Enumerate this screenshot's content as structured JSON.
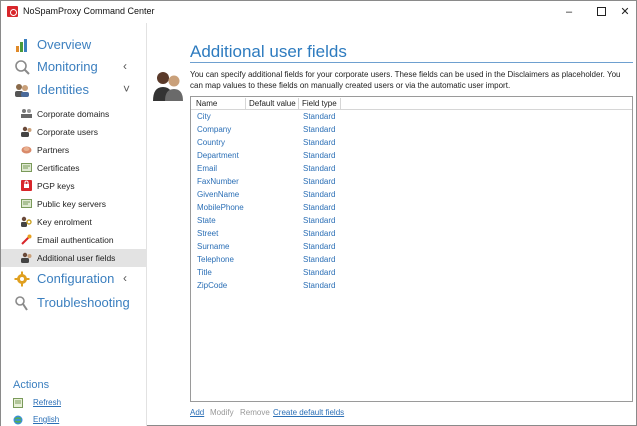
{
  "window": {
    "title": "NoSpamProxy Command Center",
    "controls": {
      "minimize": "–",
      "close": "✕"
    }
  },
  "sidebar": {
    "main_items": [
      {
        "label": "Overview",
        "icon": "overview-icon",
        "chevron": ""
      },
      {
        "label": "Monitoring",
        "icon": "monitoring-icon",
        "chevron": "‹"
      },
      {
        "label": "Identities",
        "icon": "identities-icon",
        "chevron": "˅"
      },
      {
        "label": "Configuration",
        "icon": "configuration-icon",
        "chevron": "‹"
      },
      {
        "label": "Troubleshooting",
        "icon": "troubleshooting-icon",
        "chevron": ""
      }
    ],
    "sub_items": [
      {
        "label": "Corporate domains",
        "icon": "corporate-domains-icon"
      },
      {
        "label": "Corporate users",
        "icon": "corporate-users-icon"
      },
      {
        "label": "Partners",
        "icon": "partners-icon"
      },
      {
        "label": "Certificates",
        "icon": "certificates-icon"
      },
      {
        "label": "PGP keys",
        "icon": "pgp-keys-icon"
      },
      {
        "label": "Public key servers",
        "icon": "public-key-servers-icon"
      },
      {
        "label": "Key enrolment",
        "icon": "key-enrolment-icon"
      },
      {
        "label": "Email authentication",
        "icon": "email-authentication-icon"
      },
      {
        "label": "Additional user fields",
        "icon": "additional-user-fields-icon",
        "active": true
      }
    ],
    "actions_title": "Actions",
    "actions": [
      {
        "label": "Refresh",
        "icon": "refresh-icon"
      },
      {
        "label": "English",
        "icon": "language-globe-icon"
      }
    ]
  },
  "main": {
    "title": "Additional user fields",
    "description": "You can specify additional fields for your corporate users. These fields can be used in the Disclaimers as placeholder. You can map values to these fields on manually created users or via the automatic user import.",
    "table": {
      "columns": [
        "Name",
        "Default value",
        "Field type"
      ],
      "rows": [
        {
          "name": "City",
          "default": "",
          "type": "Standard"
        },
        {
          "name": "Company",
          "default": "",
          "type": "Standard"
        },
        {
          "name": "Country",
          "default": "",
          "type": "Standard"
        },
        {
          "name": "Department",
          "default": "",
          "type": "Standard"
        },
        {
          "name": "Email",
          "default": "",
          "type": "Standard"
        },
        {
          "name": "FaxNumber",
          "default": "",
          "type": "Standard"
        },
        {
          "name": "GivenName",
          "default": "",
          "type": "Standard"
        },
        {
          "name": "MobilePhone",
          "default": "",
          "type": "Standard"
        },
        {
          "name": "State",
          "default": "",
          "type": "Standard"
        },
        {
          "name": "Street",
          "default": "",
          "type": "Standard"
        },
        {
          "name": "Surname",
          "default": "",
          "type": "Standard"
        },
        {
          "name": "Telephone",
          "default": "",
          "type": "Standard"
        },
        {
          "name": "Title",
          "default": "",
          "type": "Standard"
        },
        {
          "name": "ZipCode",
          "default": "",
          "type": "Standard"
        }
      ]
    },
    "footer_actions": {
      "add": "Add",
      "modify": "Modify",
      "remove": "Remove",
      "create_default": "Create default fields"
    }
  },
  "colors": {
    "accent": "#2d7bbf",
    "link": "#2b6fb6",
    "disabled": "#999999",
    "active_bg": "#e3e3e3",
    "brand_red": "#d8262b"
  }
}
